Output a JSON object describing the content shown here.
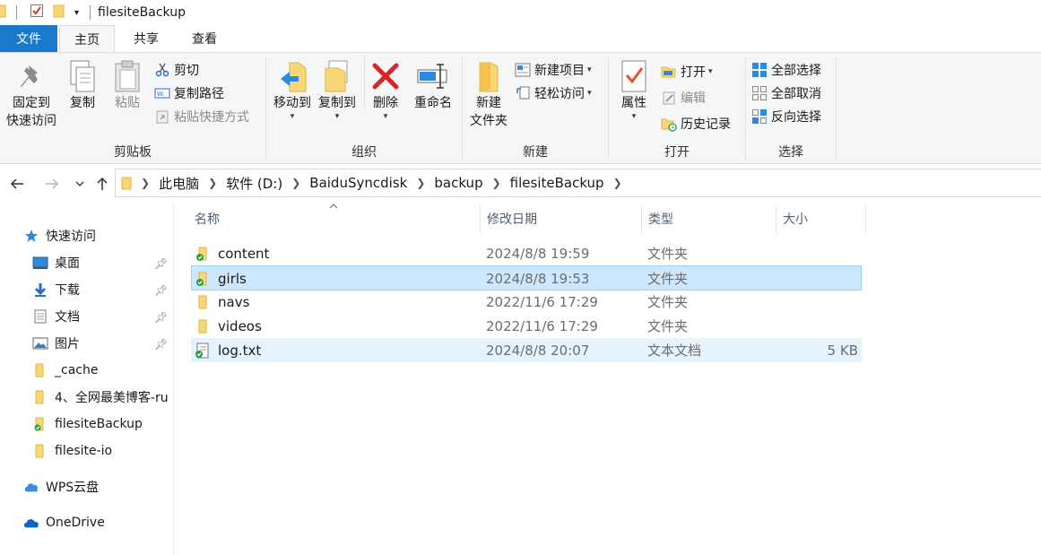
{
  "window": {
    "title": "filesiteBackup"
  },
  "tabs": {
    "file": "文件",
    "home": "主页",
    "share": "共享",
    "view": "查看"
  },
  "ribbon": {
    "clipboard": {
      "group_label": "剪贴板",
      "pin_quick_access": "固定到\n快速访问",
      "pin_line1": "固定到",
      "pin_line2": "快速访问",
      "copy": "复制",
      "paste": "粘贴",
      "cut": "剪切",
      "copy_path": "复制路径",
      "paste_shortcut": "粘贴快捷方式"
    },
    "organize": {
      "group_label": "组织",
      "move_to": "移动到",
      "copy_to": "复制到",
      "delete": "删除",
      "rename": "重命名"
    },
    "new": {
      "group_label": "新建",
      "new_folder_line1": "新建",
      "new_folder_line2": "文件夹",
      "new_item": "新建项目",
      "easy_access": "轻松访问"
    },
    "open": {
      "group_label": "打开",
      "properties": "属性",
      "open": "打开",
      "edit": "编辑",
      "history": "历史记录"
    },
    "select": {
      "group_label": "选择",
      "select_all": "全部选择",
      "select_none": "全部取消",
      "invert": "反向选择"
    }
  },
  "address": {
    "crumbs": [
      "此电脑",
      "软件 (D:)",
      "BaiduSyncdisk",
      "backup",
      "filesiteBackup"
    ]
  },
  "sidebar": {
    "items": [
      {
        "label": "快速访问",
        "icon": "star-icon"
      },
      {
        "label": "桌面",
        "icon": "desktop-icon",
        "pinned": true
      },
      {
        "label": "下载",
        "icon": "download-icon",
        "pinned": true
      },
      {
        "label": "文档",
        "icon": "document-icon",
        "pinned": true
      },
      {
        "label": "图片",
        "icon": "picture-icon",
        "pinned": true
      },
      {
        "label": "_cache",
        "icon": "folder-icon"
      },
      {
        "label": "4、全网最美博客-ru",
        "icon": "folder-icon"
      },
      {
        "label": "filesiteBackup",
        "icon": "sync-folder-icon"
      },
      {
        "label": "filesite-io",
        "icon": "folder-icon"
      },
      {
        "label": "WPS云盘",
        "icon": "cloud-icon"
      },
      {
        "label": "OneDrive",
        "icon": "onedrive-icon"
      }
    ]
  },
  "filelist": {
    "columns": {
      "name": "名称",
      "modified": "修改日期",
      "type": "类型",
      "size": "大小"
    },
    "rows": [
      {
        "name": "content",
        "modified": "2024/8/8 19:59",
        "type": "文件夹",
        "size": "",
        "kind": "folder"
      },
      {
        "name": "girls",
        "modified": "2024/8/8 19:53",
        "type": "文件夹",
        "size": "",
        "kind": "folder"
      },
      {
        "name": "navs",
        "modified": "2022/11/6 17:29",
        "type": "文件夹",
        "size": "",
        "kind": "folder"
      },
      {
        "name": "videos",
        "modified": "2022/11/6 17:29",
        "type": "文件夹",
        "size": "",
        "kind": "folder"
      },
      {
        "name": "log.txt",
        "modified": "2024/8/8 20:07",
        "type": "文本文档",
        "size": "5 KB",
        "kind": "text"
      }
    ]
  },
  "colors": {
    "accent": "#1979ca",
    "selection": "#cce8ff",
    "hover": "#e5f3ff",
    "folder": "#f8d775"
  }
}
